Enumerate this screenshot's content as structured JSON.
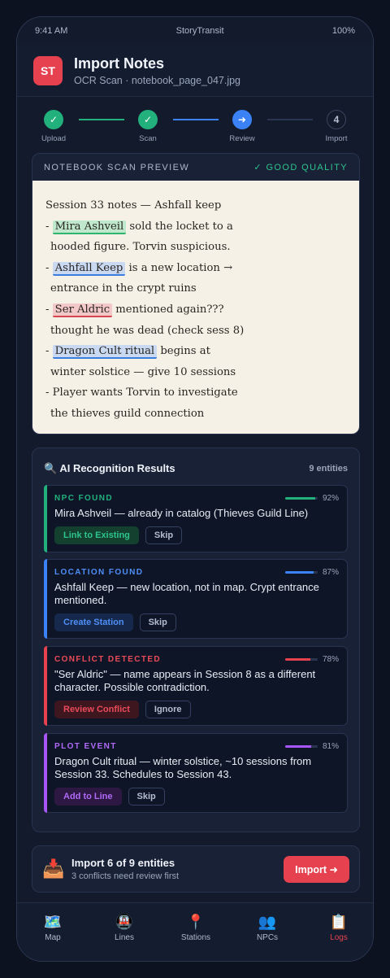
{
  "status_bar": {
    "time": "9:41 AM",
    "carrier": "StoryTransit",
    "battery": "100%"
  },
  "header": {
    "logo": "ST",
    "title": "Import Notes",
    "subtitle": "OCR Scan · notebook_page_047.jpg"
  },
  "stepper": {
    "steps": [
      {
        "label": "Upload",
        "state": "done",
        "glyph": "✓"
      },
      {
        "label": "Scan",
        "state": "done",
        "glyph": "✓"
      },
      {
        "label": "Review",
        "state": "active",
        "glyph": "➜"
      },
      {
        "label": "Import",
        "state": "pending",
        "glyph": "4"
      }
    ]
  },
  "scan": {
    "label": "NOTEBOOK SCAN PREVIEW",
    "quality": "✓ GOOD QUALITY",
    "lines": {
      "l1": "Session 33 notes — Ashfall keep",
      "l2_pre": "- ",
      "l2_hl": "Mira Ashveil",
      "l2_post": " sold the locket to a",
      "l3": "hooded figure. Torvin suspicious.",
      "l4_pre": "- ",
      "l4_hl": "Ashfall Keep",
      "l4_post": " is a new location →",
      "l5": "entrance in the crypt ruins",
      "l6_pre": "- ",
      "l6_hl": "Ser Aldric",
      "l6_post": " mentioned again???",
      "l7": "thought he was dead (check sess 8)",
      "l8_pre": "- ",
      "l8_hl": "Dragon Cult ritual",
      "l8_post": " begins at",
      "l9": "winter solstice — give 10 sessions",
      "l10": "- Player wants Torvin to investigate",
      "l11": "the thieves guild connection"
    }
  },
  "ai": {
    "icon": "🔍",
    "title": "AI Recognition Results",
    "count": "9 entities",
    "entities": [
      {
        "type": "NPC FOUND",
        "confidence": "92%",
        "confidence_value": 0.92,
        "description": "Mira Ashveil — already in catalog (Thieves Guild Line)",
        "primary": "Link to Existing",
        "secondary": "Skip",
        "color": "#22b07d"
      },
      {
        "type": "LOCATION FOUND",
        "confidence": "87%",
        "confidence_value": 0.87,
        "description": "Ashfall Keep — new location, not in map. Crypt entrance mentioned.",
        "primary": "Create Station",
        "secondary": "Skip",
        "color": "#3b82f6"
      },
      {
        "type": "CONFLICT DETECTED",
        "confidence": "78%",
        "confidence_value": 0.78,
        "description": "\"Ser Aldric\" — name appears in Session 8 as a different character. Possible contradiction.",
        "primary": "Review Conflict",
        "secondary": "Ignore",
        "color": "#e5414f"
      },
      {
        "type": "PLOT EVENT",
        "confidence": "81%",
        "confidence_value": 0.81,
        "description": "Dragon Cult ritual — winter solstice, ~10 sessions from Session 33. Schedules to Session 43.",
        "primary": "Add to Line",
        "secondary": "Skip",
        "color": "#a855f7"
      }
    ]
  },
  "import_bar": {
    "icon": "📥",
    "title": "Import 6 of 9 entities",
    "subtitle": "3 conflicts need review first",
    "button": "Import ➜"
  },
  "tabs": [
    {
      "icon": "🗺️",
      "label": "Map"
    },
    {
      "icon": "🚇",
      "label": "Lines"
    },
    {
      "icon": "📍",
      "label": "Stations"
    },
    {
      "icon": "👥",
      "label": "NPCs"
    },
    {
      "icon": "📋",
      "label": "Logs",
      "active": true
    }
  ]
}
